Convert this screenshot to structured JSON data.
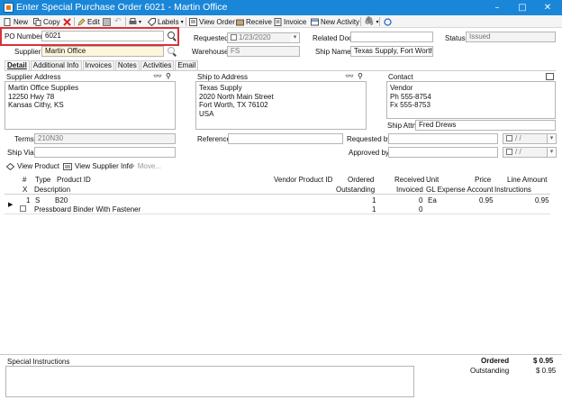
{
  "window": {
    "title": "Enter Special Purchase Order 6021 - Martin Office",
    "minimize": "–",
    "maximize": "□",
    "close": "✕"
  },
  "toolbar": {
    "new": "New",
    "copy": "Copy",
    "edit": "Edit",
    "labels": "Labels",
    "view_order": "View Order",
    "receive": "Receive",
    "invoice": "Invoice",
    "new_activity": "New Activity"
  },
  "header": {
    "po_number_label": "PO Number",
    "po_number_value": "6021",
    "supplier_label": "Supplier",
    "supplier_value": "Martin Office",
    "requested_label": "Requested",
    "requested_value": "1/23/2020",
    "warehouse_label": "Warehouse",
    "warehouse_value": "FS",
    "related_doc_label": "Related Doc",
    "related_doc_value": "",
    "ship_name_label": "Ship Name",
    "ship_name_value": "Texas Supply, Fort Worth",
    "status_label": "Status",
    "status_value": "Issued"
  },
  "tabs": [
    "Detail",
    "Additional Info",
    "Invoices",
    "Notes",
    "Activities",
    "Email"
  ],
  "detail": {
    "supplier_address_label": "Supplier Address",
    "supplier_address": "Martin Office Supplies\n12250 Hwy 78\nKansas Cithy, KS",
    "ship_to_label": "Ship to Address",
    "ship_to_address": "Texas Supply\n2020 North Main Street\nFort Worth, TX 76102\nUSA",
    "contact_label": "Contact",
    "contact": "Vendor\nPh 555-8754\nFx 555-8753",
    "ship_attn_label": "Ship Attn",
    "ship_attn_value": "Fred Drews",
    "terms_label": "Terms",
    "terms_value": "210N30",
    "ship_via_label": "Ship Via",
    "ship_via_value": "",
    "reference_label": "Reference",
    "reference_value": "",
    "requested_by_label": "Requested by",
    "approved_by_label": "Approved by",
    "date_placeholder": "/ /"
  },
  "line_toolbar": {
    "view_product": "View Product",
    "view_supplier_info": "View Supplier Info",
    "move": "Move..."
  },
  "grid": {
    "headers_row1": {
      "num": "#",
      "type": "Type",
      "product_id": "Product ID",
      "vendor_product_id": "Vendor Product ID",
      "ordered": "Ordered",
      "received": "Received",
      "unit": "Unit",
      "price": "Price",
      "line_amount": "Line Amount"
    },
    "headers_row2": {
      "x": "X",
      "description": "Description",
      "outstanding": "Outstanding",
      "invoiced": "Invoiced",
      "gl": "GL Expense Account",
      "instructions": "Instructions"
    },
    "rows": [
      {
        "num": "1",
        "type": "S",
        "product_id": "B20",
        "ordered": "1",
        "received": "0",
        "unit": "Ea",
        "price": "0.95",
        "line_amount": "0.95",
        "description": "Pressboard Binder With Fastener",
        "outstanding": "1",
        "invoiced": "0"
      }
    ]
  },
  "footer": {
    "special_instructions_label": "Special Instructions",
    "ordered_label": "Ordered",
    "ordered_value": "$ 0.95",
    "outstanding_label": "Outstanding",
    "outstanding_value": "$ 0.95"
  }
}
